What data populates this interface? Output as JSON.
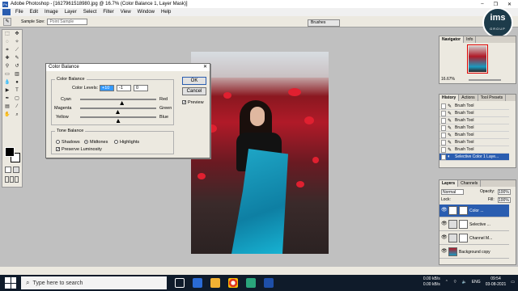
{
  "window": {
    "title": "Adobe Photoshop - [1627961518980.jpg @ 16.7% (Color Balance 1, Layer Mask)]",
    "min": "–",
    "max": "❐",
    "close": "✕"
  },
  "menu": [
    "File",
    "Edit",
    "Image",
    "Layer",
    "Select",
    "Filter",
    "View",
    "Window",
    "Help"
  ],
  "options": {
    "sample_size_label": "Sample Size:",
    "sample_size_value": "Point Sample",
    "brushes_tab": "Brushes"
  },
  "dialog": {
    "title": "Color Balance",
    "close": "✕",
    "group1_label": "Color Balance",
    "levels_label": "Color Levels:",
    "levels": [
      "+10",
      "-1",
      "0"
    ],
    "sliders": [
      {
        "left": "Cyan",
        "right": "Red",
        "value": 10
      },
      {
        "left": "Magenta",
        "right": "Green",
        "value": -1
      },
      {
        "left": "Yellow",
        "right": "Blue",
        "value": 0
      }
    ],
    "group2_label": "Tone Balance",
    "tones": [
      "Shadows",
      "Midtones",
      "Highlights"
    ],
    "tone_selected": "Midtones",
    "preserve": "Preserve Luminosity",
    "ok": "OK",
    "cancel": "Cancel",
    "preview": "Preview"
  },
  "navigator": {
    "tabs": [
      "Navigator",
      "Info"
    ],
    "zoom": "16.67%"
  },
  "history": {
    "tabs": [
      "History",
      "Actions",
      "Tool Presets"
    ],
    "items": [
      "Brush Tool",
      "Brush Tool",
      "Brush Tool",
      "Brush Tool",
      "Brush Tool",
      "Brush Tool",
      "Brush Tool",
      "Selective Color 1 Laye..."
    ]
  },
  "layers": {
    "tabs": [
      "Layers",
      "Channels"
    ],
    "mode": "Normal",
    "opacity_label": "Opacity:",
    "opacity": "100%",
    "lock_label": "Lock:",
    "fill_label": "Fill:",
    "fill": "100%",
    "rows": [
      "Color ...",
      "Selective ...",
      "Channel M...",
      "Background copy"
    ]
  },
  "logo": {
    "text": "ims",
    "sub": "GROUP"
  },
  "taskbar": {
    "search_placeholder": "Type here to search",
    "net_up": "0.00 kB/s",
    "net_down": "0.00 kB/s",
    "lang": "ENG",
    "time": "09:54",
    "date": "03-08-2021"
  },
  "colors": {
    "accent": "#2a5db0",
    "taskbar": "#0f1b2a"
  }
}
